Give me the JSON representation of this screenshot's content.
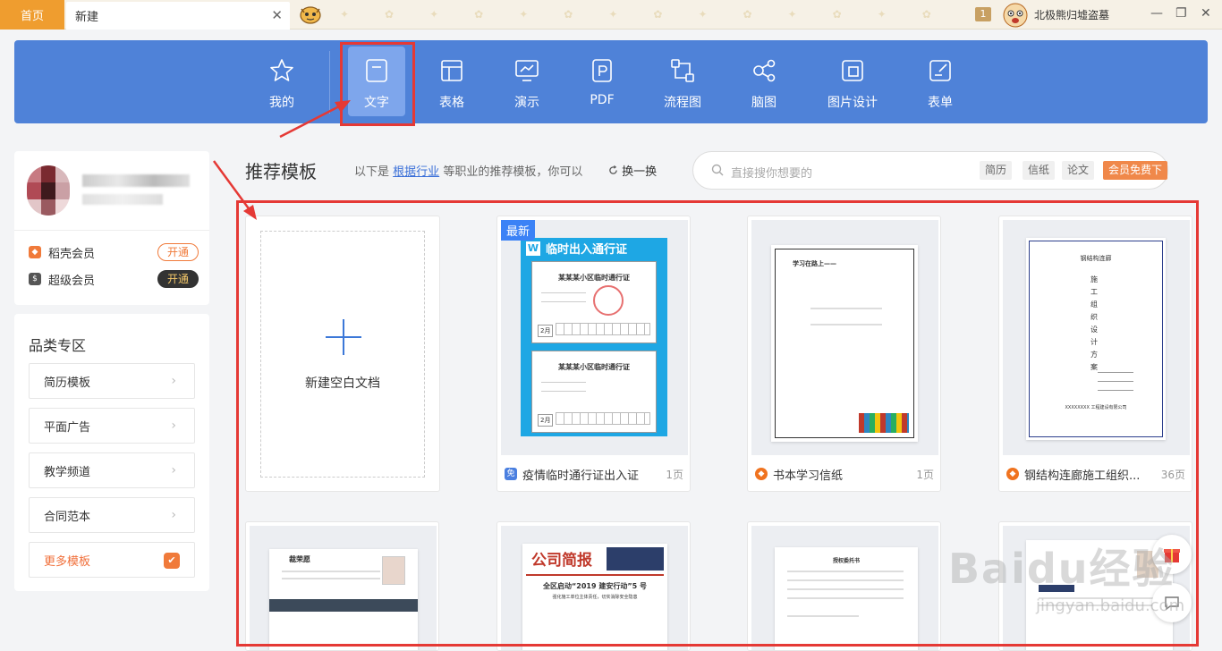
{
  "titlebar": {
    "home_tab": "首页",
    "new_tab": "新建",
    "close_glyph": "✕",
    "user_level": "1",
    "user_name": "北极熊归墟盗墓",
    "minimize": "—",
    "restore": "❐",
    "close": "✕"
  },
  "categories": [
    {
      "label": "我的",
      "icon": "star-icon"
    },
    {
      "label": "文字",
      "icon": "document-icon"
    },
    {
      "label": "表格",
      "icon": "table-icon"
    },
    {
      "label": "演示",
      "icon": "presentation-icon"
    },
    {
      "label": "PDF",
      "icon": "pdf-icon"
    },
    {
      "label": "流程图",
      "icon": "flowchart-icon"
    },
    {
      "label": "脑图",
      "icon": "mindmap-icon"
    },
    {
      "label": "图片设计",
      "icon": "image-design-icon"
    },
    {
      "label": "表单",
      "icon": "form-icon"
    }
  ],
  "membership": [
    {
      "label": "稻壳会员",
      "action": "开通",
      "color": "#f07a3a"
    },
    {
      "label": "超级会员",
      "action": "开通",
      "color": "#333333"
    }
  ],
  "category_panel": {
    "title": "品类专区",
    "items": [
      "简历模板",
      "平面广告",
      "教学频道",
      "合同范本"
    ],
    "more": "更多模板"
  },
  "templates_header": {
    "title": "推荐模板",
    "sub_prefix": "以下是",
    "sub_link": "根据行业",
    "sub_suffix": "等职业的推荐模板，你可以",
    "refresh": "换一换",
    "refresh_icon": "refresh-icon"
  },
  "search": {
    "placeholder": "直接搜你想要的",
    "tags": [
      "简历",
      "信纸",
      "论文"
    ],
    "vip_tag": "会员免费下"
  },
  "new_blank": {
    "label": "新建空白文档"
  },
  "templates": [
    {
      "name": "疫情临时通行证出入证",
      "pages": "1页",
      "badge": "最新",
      "icon_text": "免"
    },
    {
      "name": "书本学习信纸",
      "pages": "1页"
    },
    {
      "name": "钢结构连廊施工组织...",
      "pages": "36页"
    }
  ],
  "thumb_text": {
    "pass_header": "临时出入通行证",
    "pass_title_1": "某某某小区临时通行证",
    "pass_title_2": "某某某小区临时通行证",
    "pass_month": "2月",
    "letter_heading": "学习在路上——",
    "steel_company": "钢结构连廊",
    "steel_vertical": "施工组织设计方案",
    "steel_footer": "XXXXXXXX 工程建设有限公司",
    "news_title": "公司简报",
    "news_headline": "全区启动“2019 建安行动”5 号",
    "news_sub": "强化施工单位主体责任，切实消除安全隐患",
    "auth_title": "授权委托书",
    "resume_name": "裁荣愿"
  },
  "watermark": {
    "main": "Baidu经验",
    "sub": "jingyan.baidu.com"
  },
  "colors": {
    "accent": "#4f82d8",
    "home_tab": "#ef9d2f",
    "annotation": "#e53935",
    "vip": "#f0884a"
  }
}
